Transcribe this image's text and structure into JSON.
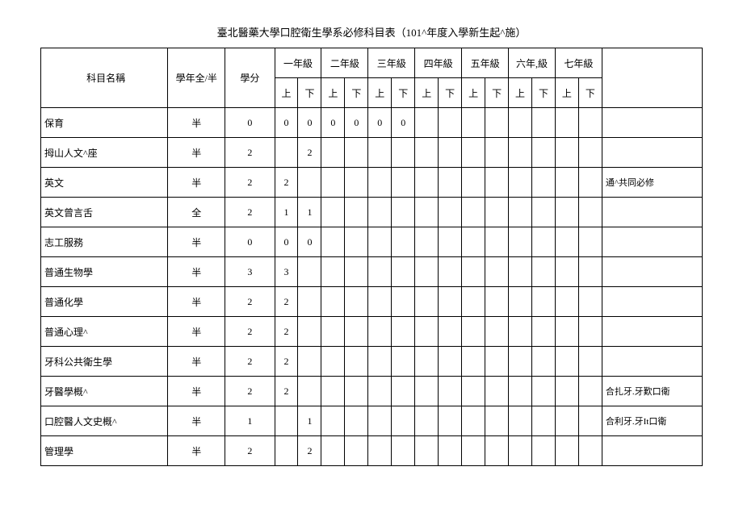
{
  "title": "臺北醫藥大學口腔衛生學系必修科目表（101^年度入學新生起^施）",
  "headers": {
    "subject": "科目名稱",
    "fullhalf": "學年全/半",
    "credit": "學分",
    "years": [
      "一年級",
      "二年級",
      "三年級",
      "四年級",
      "五年級",
      "六年,級",
      "七年級"
    ],
    "up": "上",
    "down": "下",
    "note": ""
  },
  "rows": [
    {
      "subject": "保育",
      "fh": "半",
      "credit": "0",
      "g": [
        "0",
        "0",
        "0",
        "0",
        "0",
        "0",
        "",
        "",
        "",
        "",
        "",
        "",
        "",
        ""
      ],
      "note": ""
    },
    {
      "subject": "拇山人文^座",
      "fh": "半",
      "credit": "2",
      "g": [
        "",
        "2",
        "",
        "",
        "",
        "",
        "",
        "",
        "",
        "",
        "",
        "",
        "",
        ""
      ],
      "note": ""
    },
    {
      "subject": "英文",
      "fh": "半",
      "credit": "2",
      "g": [
        "2",
        "",
        "",
        "",
        "",
        "",
        "",
        "",
        "",
        "",
        "",
        "",
        "",
        ""
      ],
      "note": "通^共同必修"
    },
    {
      "subject": "英文曾言舌",
      "fh": "全",
      "credit": "2",
      "g": [
        "1",
        "1",
        "",
        "",
        "",
        "",
        "",
        "",
        "",
        "",
        "",
        "",
        "",
        ""
      ],
      "note": ""
    },
    {
      "subject": "志工服務",
      "fh": "半",
      "credit": "0",
      "g": [
        "0",
        "0",
        "",
        "",
        "",
        "",
        "",
        "",
        "",
        "",
        "",
        "",
        "",
        ""
      ],
      "note": ""
    },
    {
      "subject": "普通生物學",
      "fh": "半",
      "credit": "3",
      "g": [
        "3",
        "",
        "",
        "",
        "",
        "",
        "",
        "",
        "",
        "",
        "",
        "",
        "",
        ""
      ],
      "note": ""
    },
    {
      "subject": "普通化學",
      "fh": "半",
      "credit": "2",
      "g": [
        "2",
        "",
        "",
        "",
        "",
        "",
        "",
        "",
        "",
        "",
        "",
        "",
        "",
        ""
      ],
      "note": ""
    },
    {
      "subject": "普通心理^",
      "fh": "半",
      "credit": "2",
      "g": [
        "2",
        "",
        "",
        "",
        "",
        "",
        "",
        "",
        "",
        "",
        "",
        "",
        "",
        ""
      ],
      "note": ""
    },
    {
      "subject": "牙科公共衛生學",
      "fh": "半",
      "credit": "2",
      "g": [
        "2",
        "",
        "",
        "",
        "",
        "",
        "",
        "",
        "",
        "",
        "",
        "",
        "",
        ""
      ],
      "note": ""
    },
    {
      "subject": "牙醫學概^",
      "fh": "半",
      "credit": "2",
      "g": [
        "2",
        "",
        "",
        "",
        "",
        "",
        "",
        "",
        "",
        "",
        "",
        "",
        "",
        ""
      ],
      "note": "合扎牙.牙歎口衛"
    },
    {
      "subject": "口腔醫人文史概^",
      "fh": "半",
      "credit": "1",
      "g": [
        "",
        "1",
        "",
        "",
        "",
        "",
        "",
        "",
        "",
        "",
        "",
        "",
        "",
        ""
      ],
      "note": "合利牙.牙It口衛"
    },
    {
      "subject": "管理學",
      "fh": "半",
      "credit": "2",
      "g": [
        "",
        "2",
        "",
        "",
        "",
        "",
        "",
        "",
        "",
        "",
        "",
        "",
        "",
        ""
      ],
      "note": ""
    }
  ]
}
